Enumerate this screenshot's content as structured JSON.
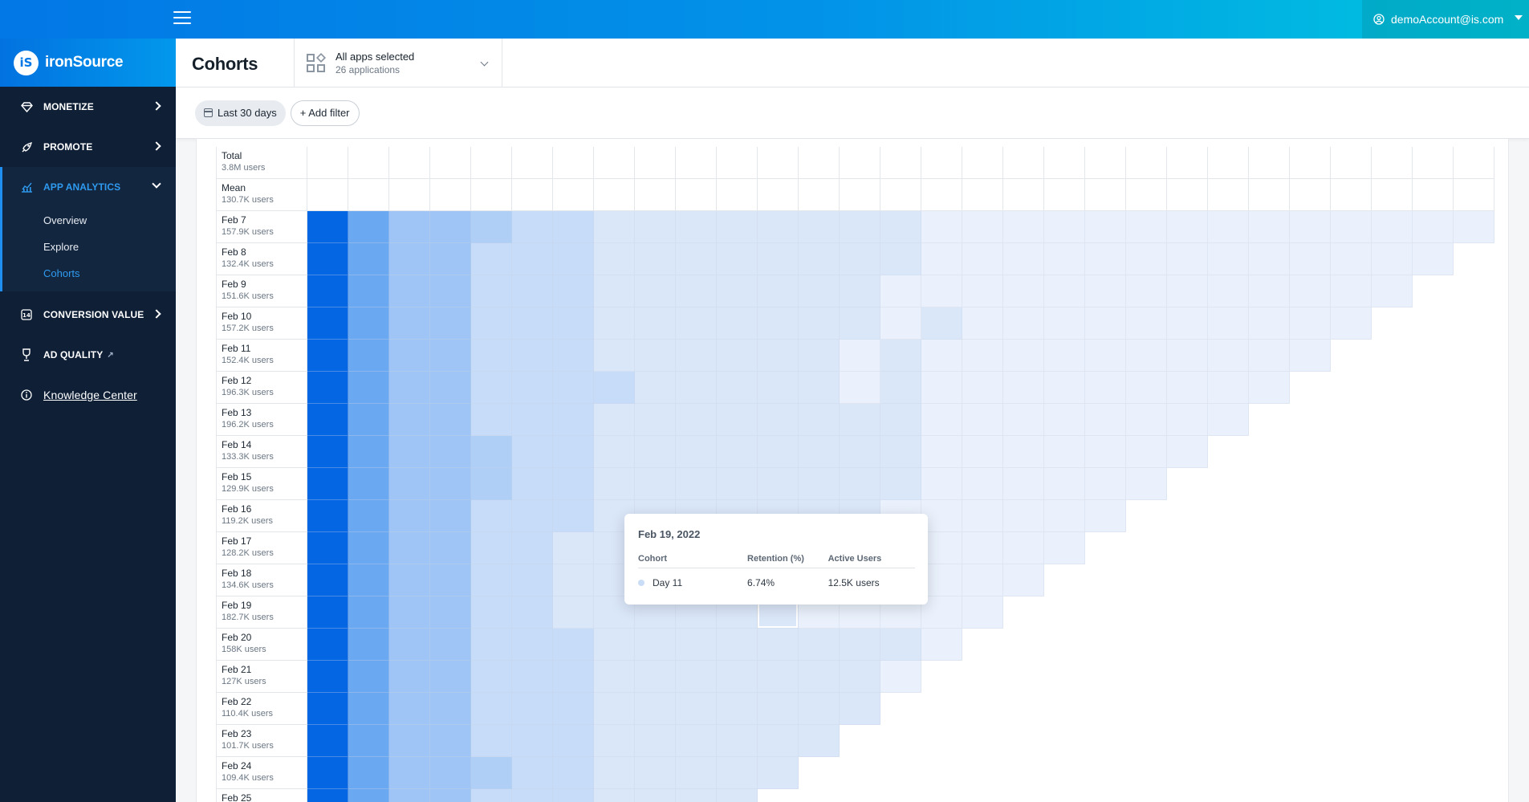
{
  "topbar": {
    "account_email": "demoAccount@is.com"
  },
  "brand": {
    "logo_mark": "iS",
    "name": "ironSource"
  },
  "sidebar": {
    "items": [
      {
        "label": "MONETIZE",
        "icon": "diamond-icon"
      },
      {
        "label": "PROMOTE",
        "icon": "rocket-icon"
      },
      {
        "label": "APP ANALYTICS",
        "icon": "analytics-icon"
      },
      {
        "label": "CONVERSION VALUE",
        "icon": "conversion-icon"
      },
      {
        "label": "AD QUALITY",
        "icon": "trophy-icon"
      },
      {
        "label": "Knowledge Center",
        "icon": "info-icon"
      }
    ],
    "analytics_sub": [
      "Overview",
      "Explore",
      "Cohorts"
    ],
    "active_sub": "Cohorts"
  },
  "header": {
    "title": "Cohorts",
    "app_selector": {
      "line1": "All apps selected",
      "line2": "26 applications"
    }
  },
  "filters": {
    "date": "Last 30 days",
    "add": "+ Add filter"
  },
  "cohort_table": {
    "columns": 29,
    "summary_rows": [
      {
        "label": "Total",
        "users": "3.8M users"
      },
      {
        "label": "Mean",
        "users": "130.7K users"
      }
    ],
    "rows": [
      {
        "label": "Feb 7",
        "users": "157.9K users",
        "levels": [
          5,
          4,
          3,
          3,
          2,
          1,
          1,
          0,
          0,
          0,
          0,
          0,
          0,
          0,
          0,
          -1,
          -1,
          -1,
          -1,
          -1,
          -1,
          -1,
          -1,
          -1,
          -1,
          -1,
          -1,
          -1,
          -1
        ]
      },
      {
        "label": "Feb 8",
        "users": "132.4K users",
        "levels": [
          5,
          4,
          3,
          3,
          1,
          1,
          1,
          0,
          0,
          0,
          0,
          0,
          0,
          0,
          0,
          -1,
          -1,
          -1,
          -1,
          -1,
          -1,
          -1,
          -1,
          -1,
          -1,
          -1,
          -1,
          -1
        ]
      },
      {
        "label": "Feb 9",
        "users": "151.6K users",
        "levels": [
          5,
          4,
          3,
          3,
          1,
          1,
          1,
          0,
          0,
          0,
          0,
          0,
          0,
          0,
          -1,
          -1,
          -1,
          -1,
          -1,
          -1,
          -1,
          -1,
          -1,
          -1,
          -1,
          -1,
          -1
        ]
      },
      {
        "label": "Feb 10",
        "users": "157.2K users",
        "levels": [
          5,
          4,
          3,
          3,
          1,
          1,
          1,
          0,
          0,
          0,
          0,
          0,
          0,
          0,
          -1,
          0,
          -1,
          -1,
          -1,
          -1,
          -1,
          -1,
          -1,
          -1,
          -1,
          -1
        ]
      },
      {
        "label": "Feb 11",
        "users": "152.4K users",
        "levels": [
          5,
          4,
          3,
          3,
          1,
          1,
          1,
          0,
          0,
          0,
          0,
          0,
          0,
          -1,
          0,
          -1,
          -1,
          -1,
          -1,
          -1,
          -1,
          -1,
          -1,
          -1,
          -1
        ]
      },
      {
        "label": "Feb 12",
        "users": "196.3K users",
        "levels": [
          5,
          4,
          3,
          3,
          1,
          1,
          1,
          1,
          0,
          0,
          0,
          0,
          0,
          -1,
          0,
          -1,
          -1,
          -1,
          -1,
          -1,
          -1,
          -1,
          -1,
          -1
        ]
      },
      {
        "label": "Feb 13",
        "users": "196.2K users",
        "levels": [
          5,
          4,
          3,
          3,
          1,
          1,
          1,
          0,
          0,
          0,
          0,
          0,
          0,
          0,
          0,
          -1,
          -1,
          -1,
          -1,
          -1,
          -1,
          -1,
          -1
        ]
      },
      {
        "label": "Feb 14",
        "users": "133.3K users",
        "levels": [
          5,
          4,
          3,
          3,
          2,
          1,
          1,
          0,
          0,
          0,
          0,
          0,
          0,
          0,
          0,
          -1,
          -1,
          -1,
          -1,
          -1,
          -1,
          -1
        ]
      },
      {
        "label": "Feb 15",
        "users": "129.9K users",
        "levels": [
          5,
          4,
          3,
          3,
          2,
          1,
          1,
          0,
          0,
          0,
          0,
          0,
          0,
          0,
          0,
          -1,
          -1,
          -1,
          -1,
          -1,
          -1
        ]
      },
      {
        "label": "Feb 16",
        "users": "119.2K users",
        "levels": [
          5,
          4,
          3,
          3,
          1,
          1,
          1,
          0,
          0,
          0,
          0,
          0,
          0,
          0,
          -1,
          -1,
          -1,
          -1,
          -1,
          -1
        ]
      },
      {
        "label": "Feb 17",
        "users": "128.2K users",
        "levels": [
          5,
          4,
          3,
          3,
          1,
          1,
          0,
          0,
          0,
          0,
          0,
          0,
          0,
          0,
          0,
          -1,
          -1,
          -1,
          -1
        ]
      },
      {
        "label": "Feb 18",
        "users": "134.6K users",
        "levels": [
          5,
          4,
          3,
          3,
          1,
          1,
          0,
          0,
          0,
          0,
          0,
          0,
          0,
          0,
          0,
          -1,
          -1,
          -1
        ]
      },
      {
        "label": "Feb 19",
        "users": "182.7K users",
        "levels": [
          5,
          4,
          3,
          3,
          1,
          1,
          0,
          0,
          0,
          0,
          0,
          0,
          -1,
          -1,
          -1,
          -1,
          -1
        ]
      },
      {
        "label": "Feb 20",
        "users": "158K users",
        "levels": [
          5,
          4,
          3,
          3,
          1,
          1,
          1,
          0,
          0,
          0,
          0,
          0,
          0,
          0,
          0,
          -1
        ]
      },
      {
        "label": "Feb 21",
        "users": "127K users",
        "levels": [
          5,
          4,
          3,
          3,
          1,
          1,
          1,
          0,
          0,
          0,
          0,
          0,
          0,
          0,
          -1
        ]
      },
      {
        "label": "Feb 22",
        "users": "110.4K users",
        "levels": [
          5,
          4,
          3,
          3,
          1,
          1,
          1,
          0,
          0,
          0,
          0,
          0,
          0,
          0
        ]
      },
      {
        "label": "Feb 23",
        "users": "101.7K users",
        "levels": [
          5,
          4,
          3,
          3,
          1,
          1,
          1,
          0,
          0,
          0,
          0,
          0,
          0
        ]
      },
      {
        "label": "Feb 24",
        "users": "109.4K users",
        "levels": [
          5,
          4,
          3,
          3,
          2,
          1,
          1,
          0,
          0,
          0,
          0,
          0
        ]
      },
      {
        "label": "Feb 25",
        "users": "",
        "levels": [
          5,
          4,
          3,
          3,
          1,
          1,
          1,
          0,
          0,
          0,
          0
        ]
      }
    ]
  },
  "tooltip": {
    "title": "Feb 19, 2022",
    "headers": [
      "Cohort",
      "Retention (%)",
      "Active Users"
    ],
    "row": {
      "cohort": "Day 11",
      "retention": "6.74%",
      "users": "12.5K users"
    },
    "dot_color": "#c9ddf7"
  },
  "colors": {
    "level_-1": "#eaf1fc",
    "level_0": "#dae7f9",
    "level_1": "#c6dcf8",
    "level_2": "#afcff7",
    "level_3": "#9ec5f5",
    "level_4": "#6aa9f1",
    "level_5": "#0566e4"
  }
}
